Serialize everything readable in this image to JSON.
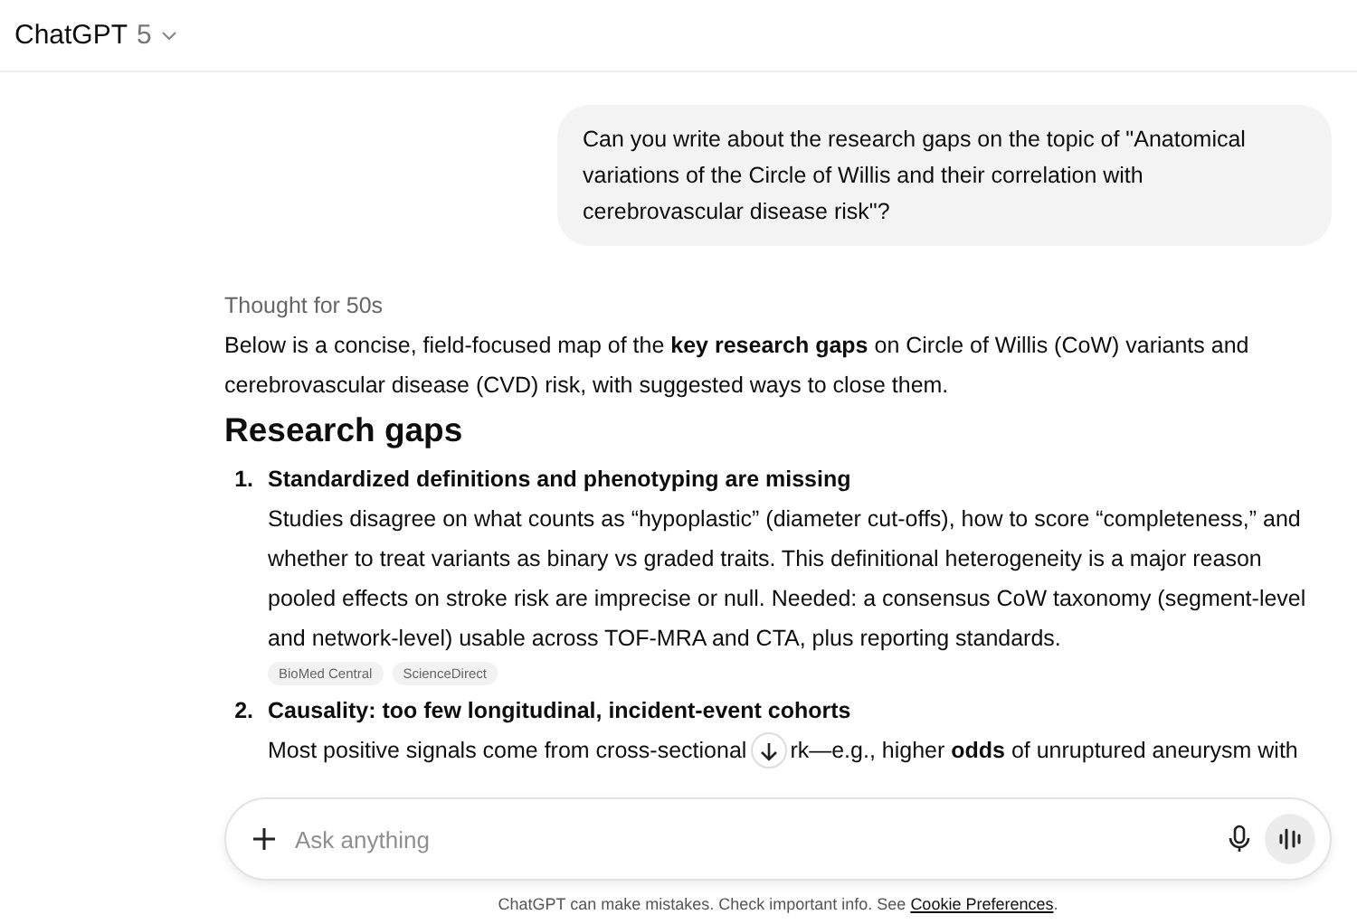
{
  "header": {
    "title": "ChatGPT",
    "version": "5"
  },
  "user_message": "Can you write about the research gaps on the topic of \"Anatomical variations of the Circle of Willis and their correlation with cerebrovascular disease risk\"?",
  "assistant": {
    "thought": "Thought for 50s",
    "intro": "Below is a concise, field-focused map of the **key research gaps** on Circle of Willis (CoW) variants and cerebrovascular disease (CVD) risk, with suggested ways to close them.",
    "heading": "Research gaps",
    "items": [
      {
        "number": "1.",
        "title": "Standardized definitions and phenotyping are missing",
        "body": "Studies disagree on what counts as “hypoplastic” (diameter cut-offs), how to score “completeness,” and whether to treat variants as binary vs graded traits. This definitional heterogeneity is a major reason pooled effects on stroke risk are imprecise or null. Needed: a consensus CoW taxonomy (segment-level and network-level) usable across TOF-MRA and CTA, plus reporting standards.",
        "sources": [
          "BioMed Central",
          "ScienceDirect"
        ]
      },
      {
        "number": "2.",
        "title": "Causality: too few longitudinal, incident-event cohorts",
        "body_before": "Most positive signals come from cross-sectional",
        "body_after": "rk—e.g., higher **odds** of unruptured aneurysm with"
      }
    ]
  },
  "composer": {
    "placeholder": "Ask anything"
  },
  "disclaimer": {
    "text": "ChatGPT can make mistakes. Check important info. See",
    "link": "Cookie Preferences",
    "end": "."
  }
}
